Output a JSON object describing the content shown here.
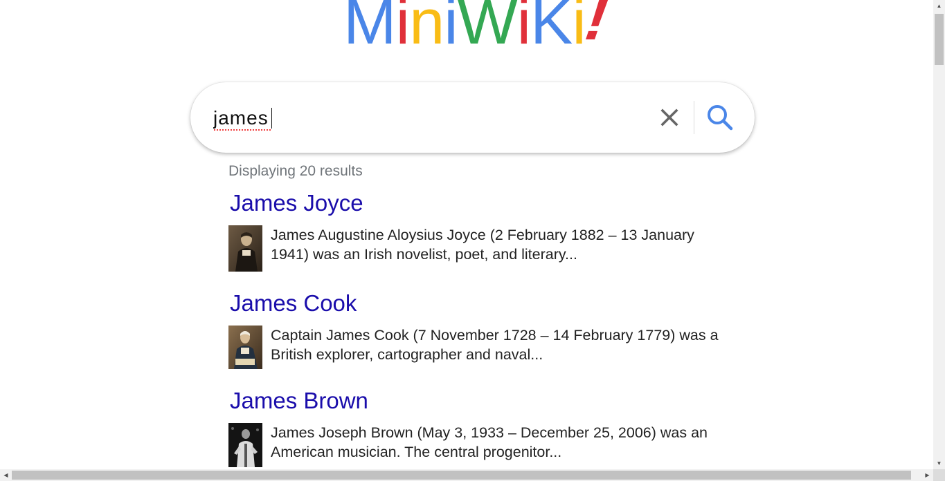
{
  "logo": {
    "letters": [
      {
        "char": "M",
        "color": "#4a86e8"
      },
      {
        "char": "i",
        "color": "#e0303a"
      },
      {
        "char": "n",
        "color": "#f9bc15"
      },
      {
        "char": "i",
        "color": "#4a86e8"
      },
      {
        "char": "W",
        "color": "#34a853"
      },
      {
        "char": "i",
        "color": "#e0303a"
      },
      {
        "char": "K",
        "color": "#4a86e8"
      },
      {
        "char": "i",
        "color": "#f9bc15"
      },
      {
        "char": "!",
        "color": "#e0303a"
      }
    ]
  },
  "search": {
    "value": "james",
    "clear_icon": "close-icon",
    "search_icon": "search-icon"
  },
  "results_summary": "Displaying 20 results",
  "results": [
    {
      "title": "James Joyce",
      "snippet": "James Augustine Aloysius Joyce (2 February 1882 – 13 January 1941) was an Irish novelist, poet, and literary...",
      "thumbnail": "portrait-thumbnail"
    },
    {
      "title": "James Cook",
      "snippet": "Captain James Cook (7 November 1728 – 14 February 1779) was a British explorer, cartographer and naval...",
      "thumbnail": "portrait-thumbnail"
    },
    {
      "title": "James Brown",
      "snippet": "James Joseph Brown (May 3, 1933 – December 25, 2006) was an American musician. The central progenitor...",
      "thumbnail": "photo-thumbnail"
    }
  ],
  "colors": {
    "link": "#1a0dab",
    "muted": "#70757a",
    "accent": "#4a86e8"
  }
}
